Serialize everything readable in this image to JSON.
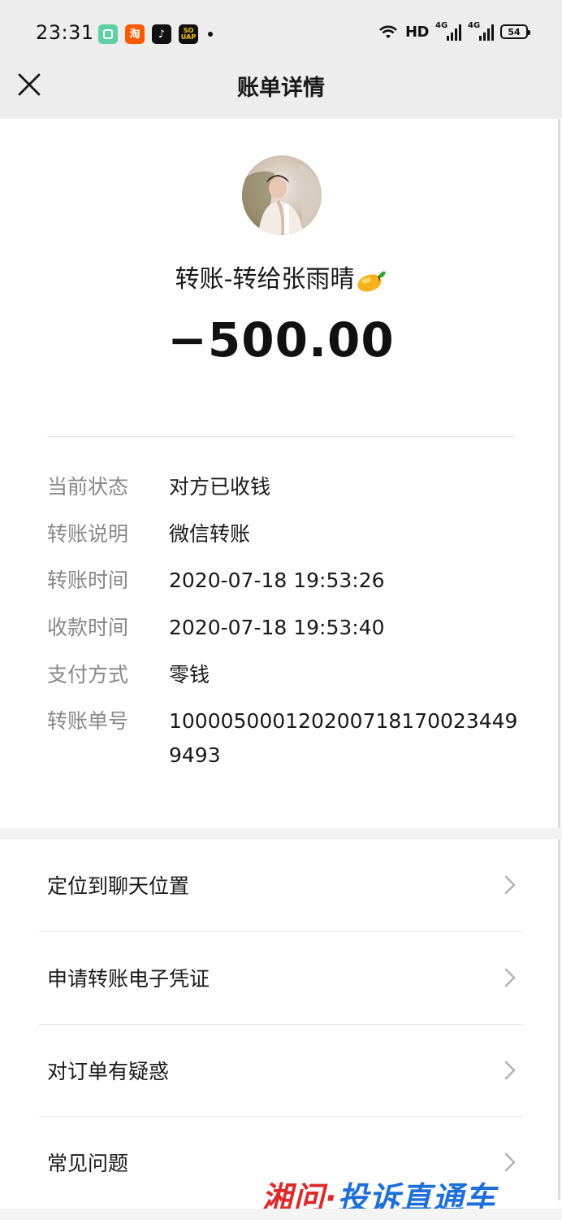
{
  "status_bar": {
    "time": "23:31",
    "apps": [
      {
        "name": "green-app-icon",
        "text": ""
      },
      {
        "name": "taobao-icon",
        "text": "淘"
      },
      {
        "name": "tiktok-icon",
        "text": "♪"
      },
      {
        "name": "soul-icon",
        "text": "SO UAP"
      }
    ],
    "network": "HD",
    "signal_labels": [
      "4G",
      "4G"
    ],
    "battery": "54"
  },
  "nav": {
    "title": "账单详情"
  },
  "transfer": {
    "title": "转账-转给张雨晴",
    "amount": "−500.00"
  },
  "details": [
    {
      "label": "当前状态",
      "value": "对方已收钱"
    },
    {
      "label": "转账说明",
      "value": "微信转账"
    },
    {
      "label": "转账时间",
      "value": "2020-07-18 19:53:26"
    },
    {
      "label": "收款时间",
      "value": "2020-07-18 19:53:40"
    },
    {
      "label": "支付方式",
      "value": "零钱"
    },
    {
      "label": "转账单号",
      "value": "100005000120200718170023449 9493"
    }
  ],
  "menu": [
    {
      "label": "定位到聊天位置"
    },
    {
      "label": "申请转账电子凭证"
    },
    {
      "label": "对订单有疑惑"
    },
    {
      "label": "常见问题"
    }
  ],
  "watermark": {
    "part1": "湘问·",
    "part2": "投诉直通车"
  },
  "colors": {
    "nav_bg": "#ededed",
    "label_gray": "#888888",
    "text": "#191919"
  }
}
